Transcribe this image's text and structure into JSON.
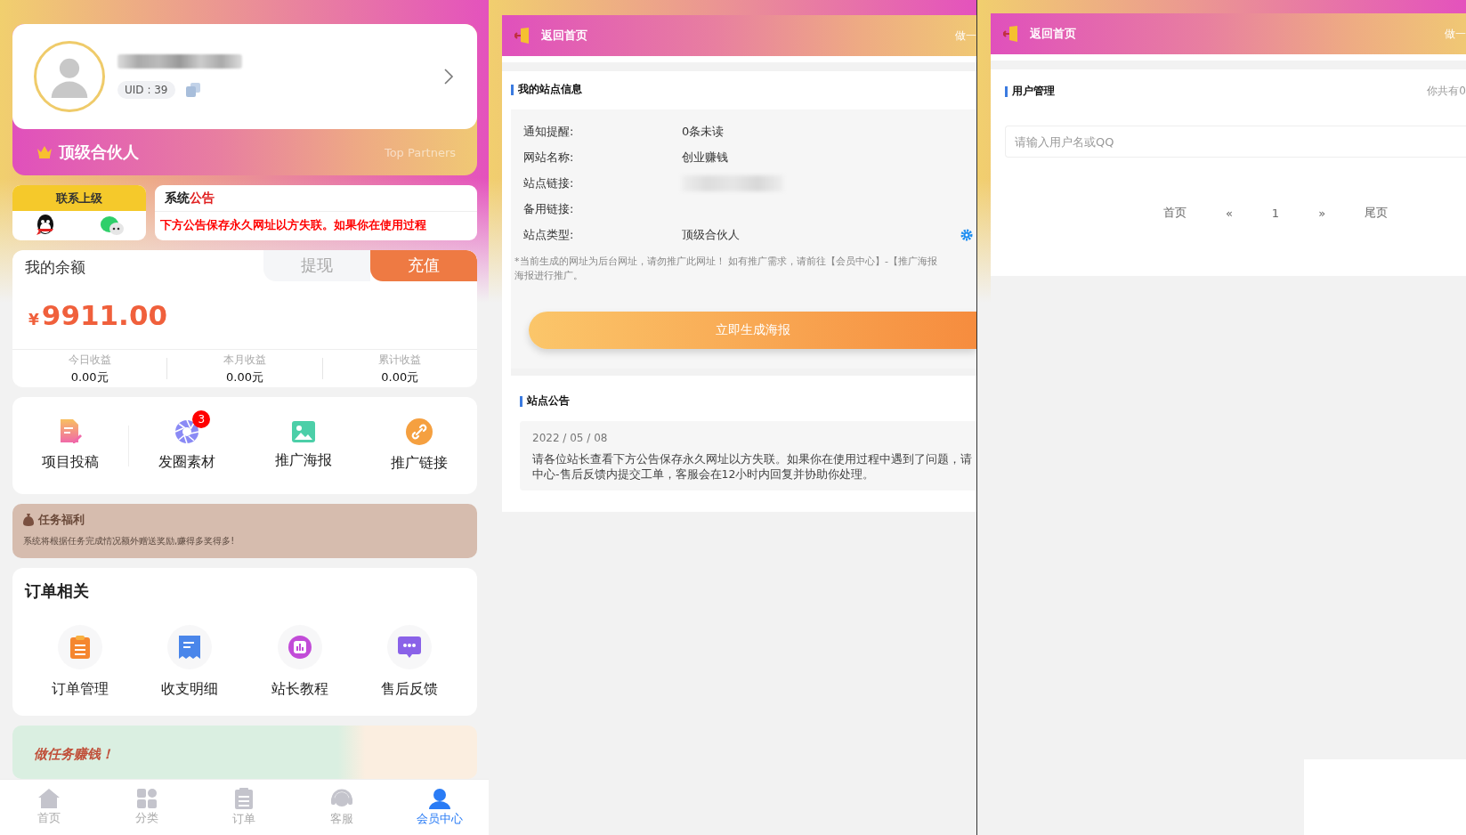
{
  "member_panel": {
    "profile": {
      "uid": "UID : 39"
    },
    "tier": {
      "name": "顶级合伙人",
      "subtitle": "Top Partners"
    },
    "contact": {
      "title": "联系上级"
    },
    "announcement": {
      "title": "系统",
      "title_highlight": "公告",
      "ticker": "下方公告保存永久网址以方失联。如果你在使用过程"
    },
    "balance": {
      "title": "我的余额",
      "tabs": [
        {
          "label": "提现",
          "selected": false
        },
        {
          "label": "充值",
          "selected": true
        }
      ],
      "currency": "¥",
      "amount": "9911.00",
      "stats": [
        {
          "label": "今日收益",
          "value": "0.00元"
        },
        {
          "label": "本月收益",
          "value": "0.00元"
        },
        {
          "label": "累计收益",
          "value": "0.00元"
        }
      ]
    },
    "shortcuts": [
      {
        "label": "项目投稿"
      },
      {
        "label": "发圈素材",
        "badge": "3"
      },
      {
        "label": "推广海报"
      },
      {
        "label": "推广链接"
      }
    ],
    "task_banner": {
      "title": "任务福利",
      "text": "系统将根据任务完成情况额外赠送奖励,赚得多奖得多!"
    },
    "orders": {
      "title": "订单相关",
      "items": [
        {
          "label": "订单管理"
        },
        {
          "label": "收支明细"
        },
        {
          "label": "站长教程"
        },
        {
          "label": "售后反馈"
        }
      ]
    },
    "promo_banner": {
      "title": "做任务赚钱！"
    },
    "nav": [
      {
        "label": "首页",
        "selected": false
      },
      {
        "label": "分类",
        "selected": false
      },
      {
        "label": "订单",
        "selected": false
      },
      {
        "label": "客服",
        "selected": false
      },
      {
        "label": "会员中心",
        "selected": true
      }
    ]
  },
  "site_panel": {
    "header": {
      "back": "返回首页",
      "right": "做一"
    },
    "info_title": "我的站点信息",
    "rows": [
      {
        "label": "通知提醒:",
        "value": "0条未读"
      },
      {
        "label": "网站名称:",
        "value": "创业赚钱"
      },
      {
        "label": "站点链接:",
        "kind": "blurred"
      },
      {
        "label": "备用链接:"
      },
      {
        "label": "站点类型:",
        "value": "顶级合伙人",
        "kind": "settings"
      }
    ],
    "note": [
      "*当前生成的网址为后台网址，请勿推广此网址！ 如有推广需求，请前往【会员中心】-【推广海报",
      "海报进行推广。"
    ],
    "button": "立即生成海报",
    "notice_title": "站点公告",
    "notice": {
      "date": "2022 / 05 / 08",
      "lines": [
        "请各位站长查看下方公告保存永久网址以方失联。如果你在使用过程中遇到了问题，请",
        "中心-售后反馈内提交工单，客服会在12小时内回复并协助你处理。"
      ]
    }
  },
  "user_panel": {
    "header": {
      "back": "返回首页",
      "right": "做一"
    },
    "title": "用户管理",
    "count": "你共有0",
    "search": {
      "placeholder": "请输入用户名或QQ"
    },
    "pagination": [
      "首页",
      "«",
      "1",
      "»",
      "尾页"
    ]
  }
}
